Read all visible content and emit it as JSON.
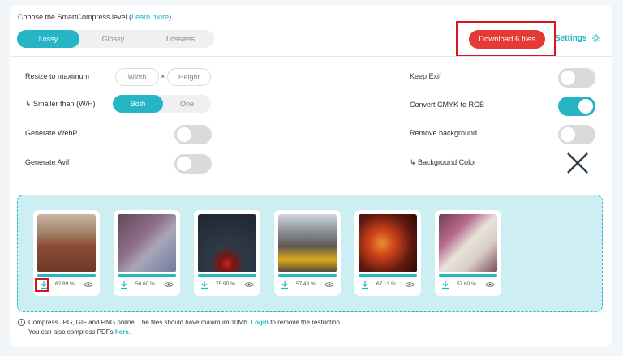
{
  "level": {
    "label_prefix": "Choose the SmartCompress level (",
    "learn_more": "Learn more",
    "label_suffix": ")",
    "tabs": [
      "Lossy",
      "Glossy",
      "Lossless"
    ],
    "active": "Lossy"
  },
  "download_label": "Download 6 files",
  "settings_label": "Settings",
  "options": {
    "resize_label": "Resize to maximum",
    "width_placeholder": "Width",
    "times": "×",
    "height_placeholder": "Height",
    "smaller_label": "↳ Smaller than (W/H)",
    "smaller_options": [
      "Both",
      "One"
    ],
    "generate_webp": "Generate WebP",
    "generate_avif": "Generate Avif",
    "keep_exif": "Keep Exif",
    "convert_cmyk": "Convert CMYK to RGB",
    "remove_bg": "Remove background",
    "bg_color": "↳ Background Color",
    "toggles": {
      "webp": false,
      "avif": false,
      "exif": false,
      "cmyk": true,
      "remove_bg": false
    }
  },
  "files": [
    {
      "pct": "62.89 %"
    },
    {
      "pct": "56.60 %"
    },
    {
      "pct": "75.90 %"
    },
    {
      "pct": "57.43 %"
    },
    {
      "pct": "67.13 %"
    },
    {
      "pct": "57.60 %"
    }
  ],
  "note": {
    "line1_a": "Compress JPG, GIF and PNG online. The files should have maximum 10Mb. ",
    "login": "Login",
    "line1_b": " to remove the restriction.",
    "line2_a": "You can also compress PDFs ",
    "here": "here",
    "line2_b": "."
  },
  "colors": {
    "accent": "#25b5c5",
    "download": "#e53935",
    "highlight": "#d9151e"
  }
}
